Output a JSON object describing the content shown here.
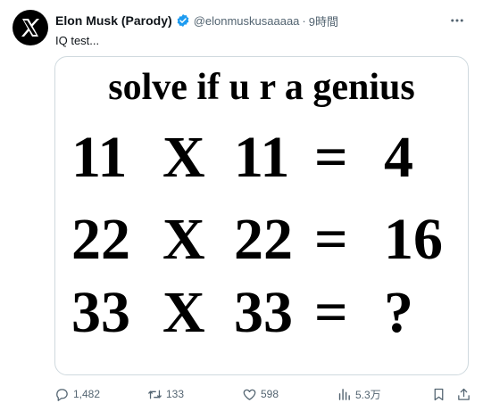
{
  "author": {
    "display_name": "Elon Musk (Parody)",
    "handle": "@elonmuskusaaaaa",
    "separator": "·",
    "time": "9時間",
    "verified_color": "#1d9bf0"
  },
  "tweet": {
    "text": "IQ test..."
  },
  "media": {
    "title": "solve if u r a genius",
    "rows": [
      {
        "a": "11",
        "op": "X",
        "b": "11",
        "eq": "=",
        "result": "4"
      },
      {
        "a": "22",
        "op": "X",
        "b": "22",
        "eq": "=",
        "result": "16"
      },
      {
        "a": "33",
        "op": "X",
        "b": "33",
        "eq": "=",
        "result": "?"
      }
    ]
  },
  "actions": {
    "reply_count": "1,482",
    "retweet_count": "133",
    "like_count": "598",
    "views_count": "5.3万"
  },
  "icons": {
    "avatar": "x-logo-icon",
    "verified": "verified-badge-icon",
    "more": "more-icon",
    "reply": "reply-icon",
    "retweet": "retweet-icon",
    "like": "heart-icon",
    "views": "views-icon",
    "bookmark": "bookmark-icon",
    "share": "share-icon"
  }
}
